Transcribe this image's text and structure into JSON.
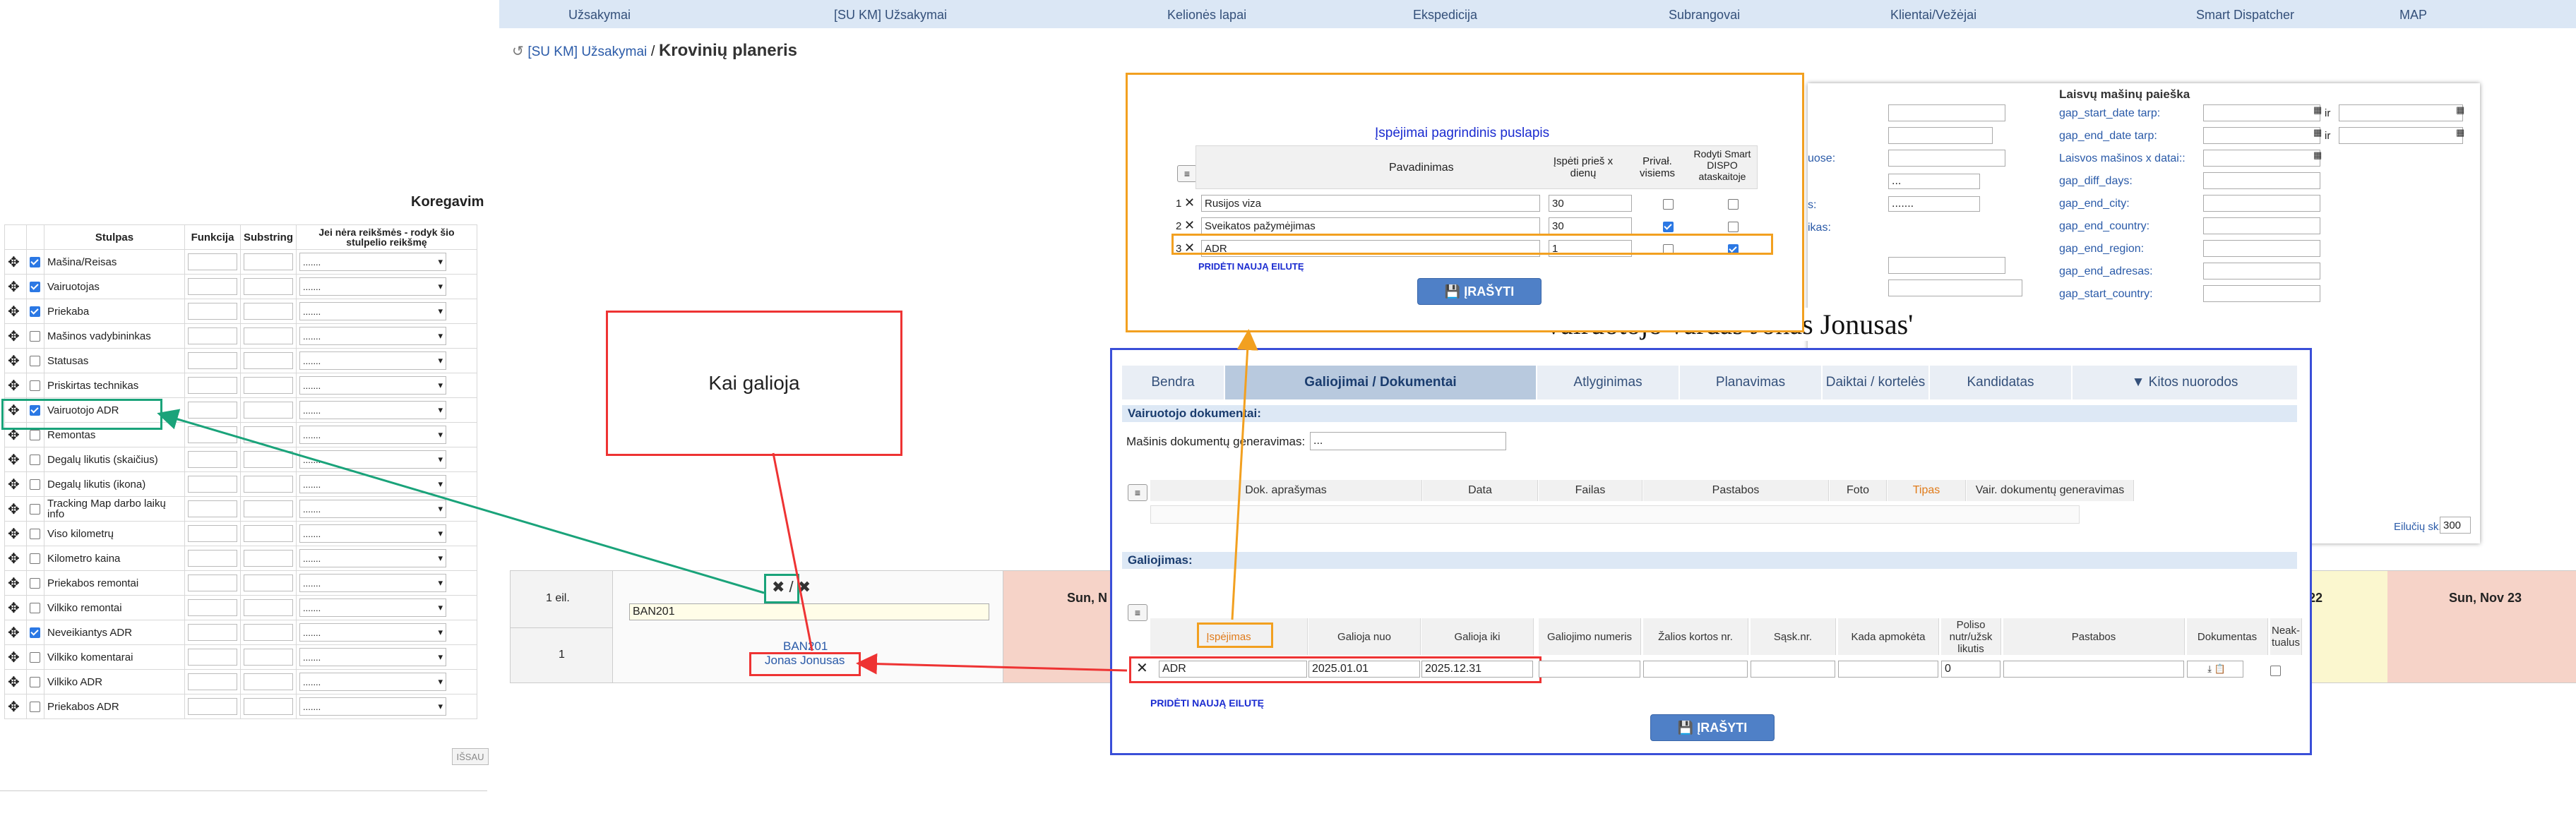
{
  "topnav": {
    "items": [
      "Užsakymai",
      "[SU KM] Užsakymai",
      "Kelionės lapai",
      "Ekspedicija",
      "Subrangovai",
      "Klientai/Vežėjai",
      "Smart Dispatcher",
      "MAP"
    ]
  },
  "breadcrumb": {
    "link": "[SU KM] Užsakymai",
    "separator": "/",
    "title": "Krovinių planeris"
  },
  "left_panel": {
    "heading": "Koregavim",
    "headers": {
      "column": "Stulpas",
      "function": "Funkcija",
      "substring": "Substring",
      "empty": "Jei nėra reikšmės - rodyk šio stulpelio reikšmę"
    },
    "rows": [
      {
        "label": "Mašina/Reisas",
        "checked": true
      },
      {
        "label": "Vairuotojas",
        "checked": true
      },
      {
        "label": "Priekaba",
        "checked": true
      },
      {
        "label": "Mašinos vadybininkas",
        "checked": false
      },
      {
        "label": "Statusas",
        "checked": false
      },
      {
        "label": "Priskirtas technikas",
        "checked": false
      },
      {
        "label": "Vairuotojo ADR",
        "checked": true
      },
      {
        "label": "Remontas",
        "checked": false
      },
      {
        "label": "Degalų likutis (skaičius)",
        "checked": false
      },
      {
        "label": "Degalų likutis (ikona)",
        "checked": false
      },
      {
        "label": "Tracking Map darbo laikų info",
        "checked": false
      },
      {
        "label": "Viso kilometrų",
        "checked": false
      },
      {
        "label": "Kilometro kaina",
        "checked": false
      },
      {
        "label": "Priekabos remontai",
        "checked": false
      },
      {
        "label": "Vilkiko remontai",
        "checked": false
      },
      {
        "label": "Neveikiantys ADR",
        "checked": true
      },
      {
        "label": "Vilkiko komentarai",
        "checked": false
      },
      {
        "label": "Vilkiko ADR",
        "checked": false
      },
      {
        "label": "Priekabos ADR",
        "checked": false
      }
    ],
    "select_placeholder": ".......",
    "save_button": "IŠSAU"
  },
  "planner": {
    "row_label_1": "1 eil.",
    "row_label_2": "1",
    "plate_input": "BAN201",
    "plate_link": "BAN201",
    "driver_link": "Jonas Jonusas",
    "day_left": "Sun, N",
    "day_22": "22",
    "day_right": "Sun, Nov 23"
  },
  "callout": {
    "text": "Kai galioja"
  },
  "warnings_panel": {
    "title": "Įspėjimai pagrindinis puslapis",
    "headers": {
      "name": "Pavadinimas",
      "days": "Įspėti prieš x dienų",
      "required": "Privał. visiems",
      "show": "Rodyti Smart DISPO ataskaitoje"
    },
    "rows": [
      {
        "num": "1",
        "name": "Rusijos viza",
        "days": "30",
        "required": false,
        "show": false
      },
      {
        "num": "2",
        "name": "Sveikatos pažymėjimas",
        "days": "30",
        "required": true,
        "show": false
      },
      {
        "num": "3",
        "name": "ADR",
        "days": "1",
        "required": false,
        "show": true
      }
    ],
    "add_row": "PRIDĖTI NAUJĄ EILUTĘ",
    "save": "ĮRAŠYTI"
  },
  "search_panel": {
    "title": "Laisvų mašinų paieška",
    "fields": [
      "gap_start_date tarp:",
      "gap_end_date tarp:",
      "Laisvos mašinos x datai::",
      "gap_diff_days:",
      "gap_end_city:",
      "gap_end_country:",
      "gap_end_region:",
      "gap_end_adresas:",
      "gap_start_country:"
    ],
    "ir": "ir",
    "left_fragments": [
      "uose:",
      "s:",
      "ikas:"
    ],
    "select_1": "...",
    "select_2": ".......",
    "rows_label": "Eilučių sk.:",
    "rows_value": "300"
  },
  "background_heading": "vairuotojo vardas Jonas Jonusas'",
  "driver_panel": {
    "tabs": [
      "Bendra",
      "Galiojimai / Dokumentai",
      "Atlyginimas",
      "Planavimas",
      "Daiktai / kortelės",
      "Kandidatas",
      "▼ Kitos nuorodos"
    ],
    "docs_header": "Vairuotojo dokumentai:",
    "docs_gen_label": "Mašinis dokumentų generavimas:",
    "docs_gen_value": "...",
    "docs_columns": [
      "Dok. aprašymas",
      "Data",
      "Failas",
      "Pastabos",
      "Foto",
      "Tipas",
      "Vair. dokumentų generavimas"
    ],
    "validity_header": "Galiojimas:",
    "validity_columns": [
      "Įspėjimas",
      "Galioja nuo",
      "Galioja iki",
      "Galiojimo numeris",
      "Žalios kortos nr.",
      "Sąsk.nr.",
      "Kada apmokėta",
      "Poliso nutr/užsk likutis",
      "Pastabos",
      "Dokumentas",
      "Neak-tualus"
    ],
    "validity_row": {
      "type": "ADR",
      "from": "2025.01.01",
      "to": "2025.12.31",
      "policy": "0"
    },
    "add_row": "PRIDĖTI NAUJĄ EILUTĘ",
    "save": "ĮRAŠYTI"
  },
  "colors": {
    "nav": "#dbe7f5",
    "callout": "#e33333",
    "orange": "#f2a020",
    "blue": "#3a4fd8",
    "green": "#1aa37a",
    "salmon": "#f6d3c8",
    "yellow": "#fbf7cf"
  }
}
